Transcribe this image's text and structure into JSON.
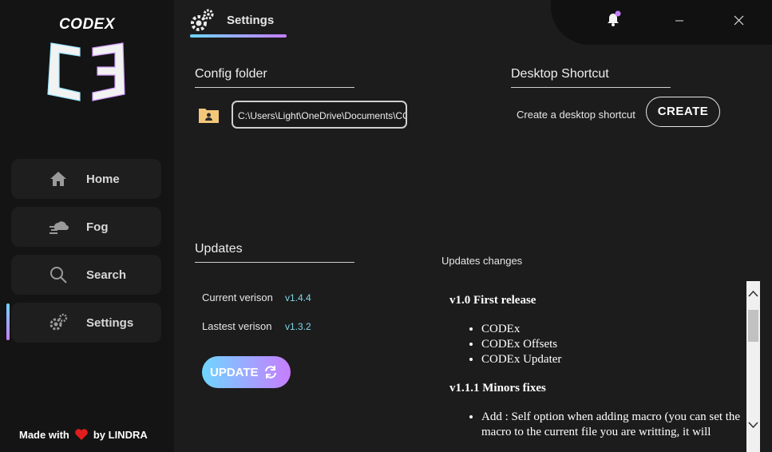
{
  "sidebar": {
    "brand": "CODEX",
    "items": [
      {
        "label": "Home",
        "icon": "home-icon"
      },
      {
        "label": "Fog",
        "icon": "fog-icon"
      },
      {
        "label": "Search",
        "icon": "search-icon"
      },
      {
        "label": "Settings",
        "icon": "gear-icon",
        "active": true
      }
    ],
    "footer": {
      "made_with": "Made with",
      "by": "by LINDRA"
    }
  },
  "header": {
    "title": "Settings"
  },
  "config": {
    "heading": "Config folder",
    "path": "C:\\Users\\Light\\OneDrive\\Documents\\CODEX"
  },
  "shortcut": {
    "heading": "Desktop Shortcut",
    "description": "Create a desktop shortcut",
    "button": "CREATE"
  },
  "updates": {
    "heading": "Updates",
    "current_label": "Current verison",
    "current_value": "v1.4.4",
    "latest_label": "Lastest verison",
    "latest_value": "v1.3.2",
    "button": "UPDATE"
  },
  "changes": {
    "label": "Updates changes",
    "entries": [
      {
        "title": "v1.0 First release",
        "items": [
          "CODEx",
          "CODEx Offsets",
          "CODEx Updater"
        ]
      },
      {
        "title": "v1.1.1 Minors fixes",
        "items": [
          "Add : Self option when adding macro (you can set the macro to the current file you are writting, it will"
        ]
      }
    ]
  },
  "colors": {
    "accent_start": "#6fd6ff",
    "accent_end": "#c77dff",
    "notification_dot": "#c77dff"
  }
}
